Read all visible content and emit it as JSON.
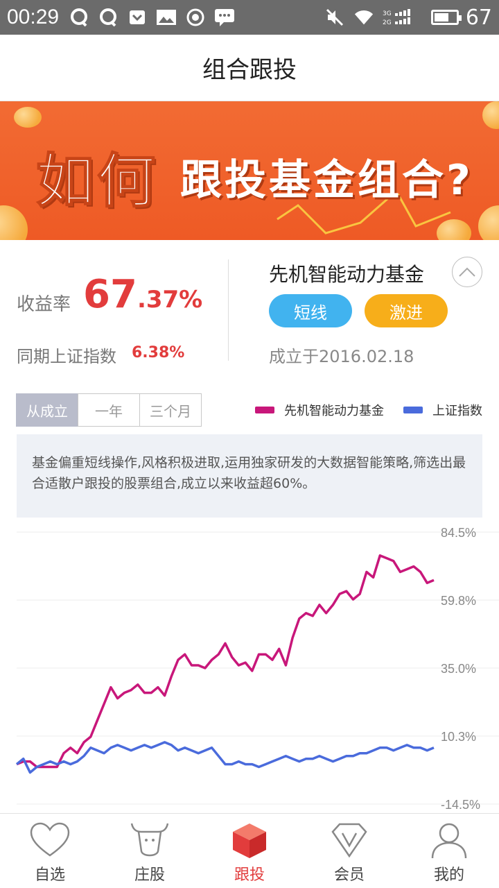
{
  "status_bar": {
    "time": "00:29",
    "battery_level": "67",
    "icons": [
      "qq-icon",
      "qq-icon",
      "pocket-icon",
      "image-icon",
      "record-icon",
      "message-icon",
      "mute-icon",
      "wifi-icon",
      "signal-icon",
      "battery-icon"
    ]
  },
  "header": {
    "title": "组合跟投"
  },
  "banner": {
    "headline_big": "如何",
    "headline_sub": "跟投基金组合?",
    "slide_count": 4,
    "active_slide": 4
  },
  "summary": {
    "yield_label": "收益率",
    "yield_int": "67",
    "yield_dec": ".37%",
    "index_label": "同期上证指数",
    "index_value": "6.38%",
    "fund_name": "先机智能动力基金",
    "tag_1": "短线",
    "tag_2": "激进",
    "founded": "成立于2016.02.18"
  },
  "range_tabs": [
    {
      "label": "从成立",
      "active": true
    },
    {
      "label": "一年",
      "active": false
    },
    {
      "label": "三个月",
      "active": false
    }
  ],
  "description": "基金偏重短线操作,风格积极进取,运用独家研发的大数据智能策略,筛选出最合适散户跟投的股票组合,成立以来收益超60%。",
  "colors": {
    "fund": "#c8177a",
    "index": "#4a6bdc",
    "accent_red": "#e23c3c",
    "tag_blue": "#41b3ef",
    "tag_orange": "#f7ae1a"
  },
  "chart_data": {
    "type": "line",
    "legend": [
      "先机智能动力基金",
      "上证指数"
    ],
    "y_tick_labels": [
      "84.5%",
      "59.8%",
      "35.0%",
      "10.3%",
      "-14.5%"
    ],
    "ylim": [
      -14.5,
      84.5
    ],
    "grid": true,
    "series": [
      {
        "name": "先机智能动力基金",
        "values": [
          0,
          1,
          1,
          -1,
          -1,
          -1,
          -1,
          4,
          6,
          4,
          8,
          10,
          16,
          22,
          28,
          24,
          26,
          27,
          29,
          26,
          26,
          28,
          25,
          32,
          38,
          40,
          36,
          36,
          35,
          38,
          40,
          44,
          39,
          36,
          37,
          34,
          40,
          40,
          38,
          42,
          36,
          46,
          53,
          55,
          54,
          58,
          55,
          58,
          62,
          63,
          60,
          62,
          70,
          68,
          76,
          75,
          74,
          70,
          71,
          72,
          70,
          66,
          67
        ]
      },
      {
        "name": "上证指数",
        "values": [
          0,
          2,
          -3,
          -1,
          0,
          1,
          0,
          1,
          0,
          1,
          3,
          6,
          5,
          4,
          6,
          7,
          6,
          5,
          6,
          7,
          6,
          7,
          8,
          7,
          5,
          6,
          5,
          4,
          5,
          6,
          3,
          0,
          0,
          1,
          0,
          0,
          -1,
          0,
          1,
          2,
          3,
          2,
          1,
          2,
          2,
          3,
          2,
          1,
          2,
          3,
          3,
          4,
          4,
          5,
          6,
          6,
          5,
          6,
          7,
          6,
          6,
          5,
          6
        ]
      }
    ]
  },
  "bottom_nav": [
    {
      "label": "自选",
      "icon": "heart-icon",
      "active": false
    },
    {
      "label": "庄股",
      "icon": "bull-icon",
      "active": false
    },
    {
      "label": "跟投",
      "icon": "cube-icon",
      "active": true
    },
    {
      "label": "会员",
      "icon": "vip-diamond-icon",
      "active": false
    },
    {
      "label": "我的",
      "icon": "user-icon",
      "active": false
    }
  ]
}
